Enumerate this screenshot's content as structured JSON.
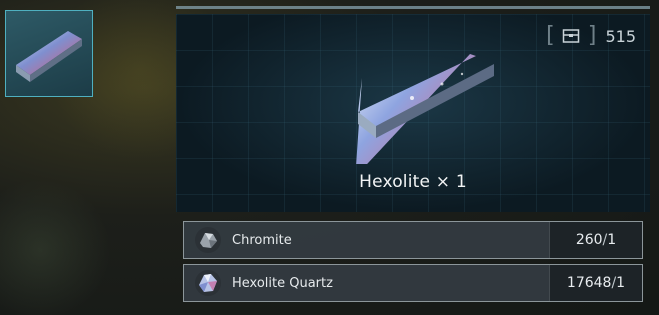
{
  "sidebar": {
    "selected_item_icon": "hexolite-ingot-icon"
  },
  "preview": {
    "counter": {
      "icon": "storage-icon",
      "value": "515"
    },
    "item_name": "Hexolite",
    "quantity_label": "× 1"
  },
  "requirements": [
    {
      "name": "Chromite",
      "owned": "260",
      "required": "1",
      "icon": "chromite-ore-icon"
    },
    {
      "name": "Hexolite Quartz",
      "owned": "17648",
      "required": "1",
      "icon": "hexolite-quartz-icon"
    }
  ],
  "colors": {
    "accent": "#4fb0c0",
    "panel": "#0c1a22",
    "row_bg": "#343c42"
  }
}
